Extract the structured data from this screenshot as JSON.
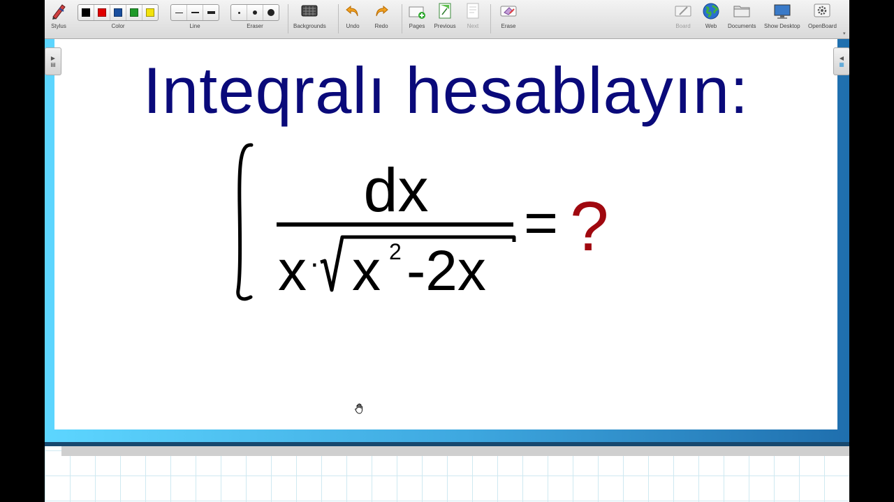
{
  "toolbar": {
    "stylus": "Stylus",
    "color": "Color",
    "line": "Line",
    "eraser": "Eraser",
    "backgrounds": "Backgrounds",
    "undo": "Undo",
    "redo": "Redo",
    "pages": "Pages",
    "previous": "Previous",
    "next": "Next",
    "erase": "Erase",
    "board": "Board",
    "web": "Web",
    "documents": "Documents",
    "show_desktop": "Show Desktop",
    "openboard": "OpenBoard",
    "colors": [
      "#000000",
      "#e00000",
      "#1a4f9e",
      "#1f9a2a",
      "#f2e20c"
    ]
  },
  "board": {
    "title": "Inteqralı hesablayın:",
    "title_color": "#0a0a7a",
    "numerator": "dx",
    "denominator_x": "x",
    "denominator_dot": "·",
    "radicand_x": "x",
    "exponent": "2",
    "radicand_rest": "-2x",
    "equals": "=",
    "question": "?",
    "question_color": "#a0080f"
  }
}
